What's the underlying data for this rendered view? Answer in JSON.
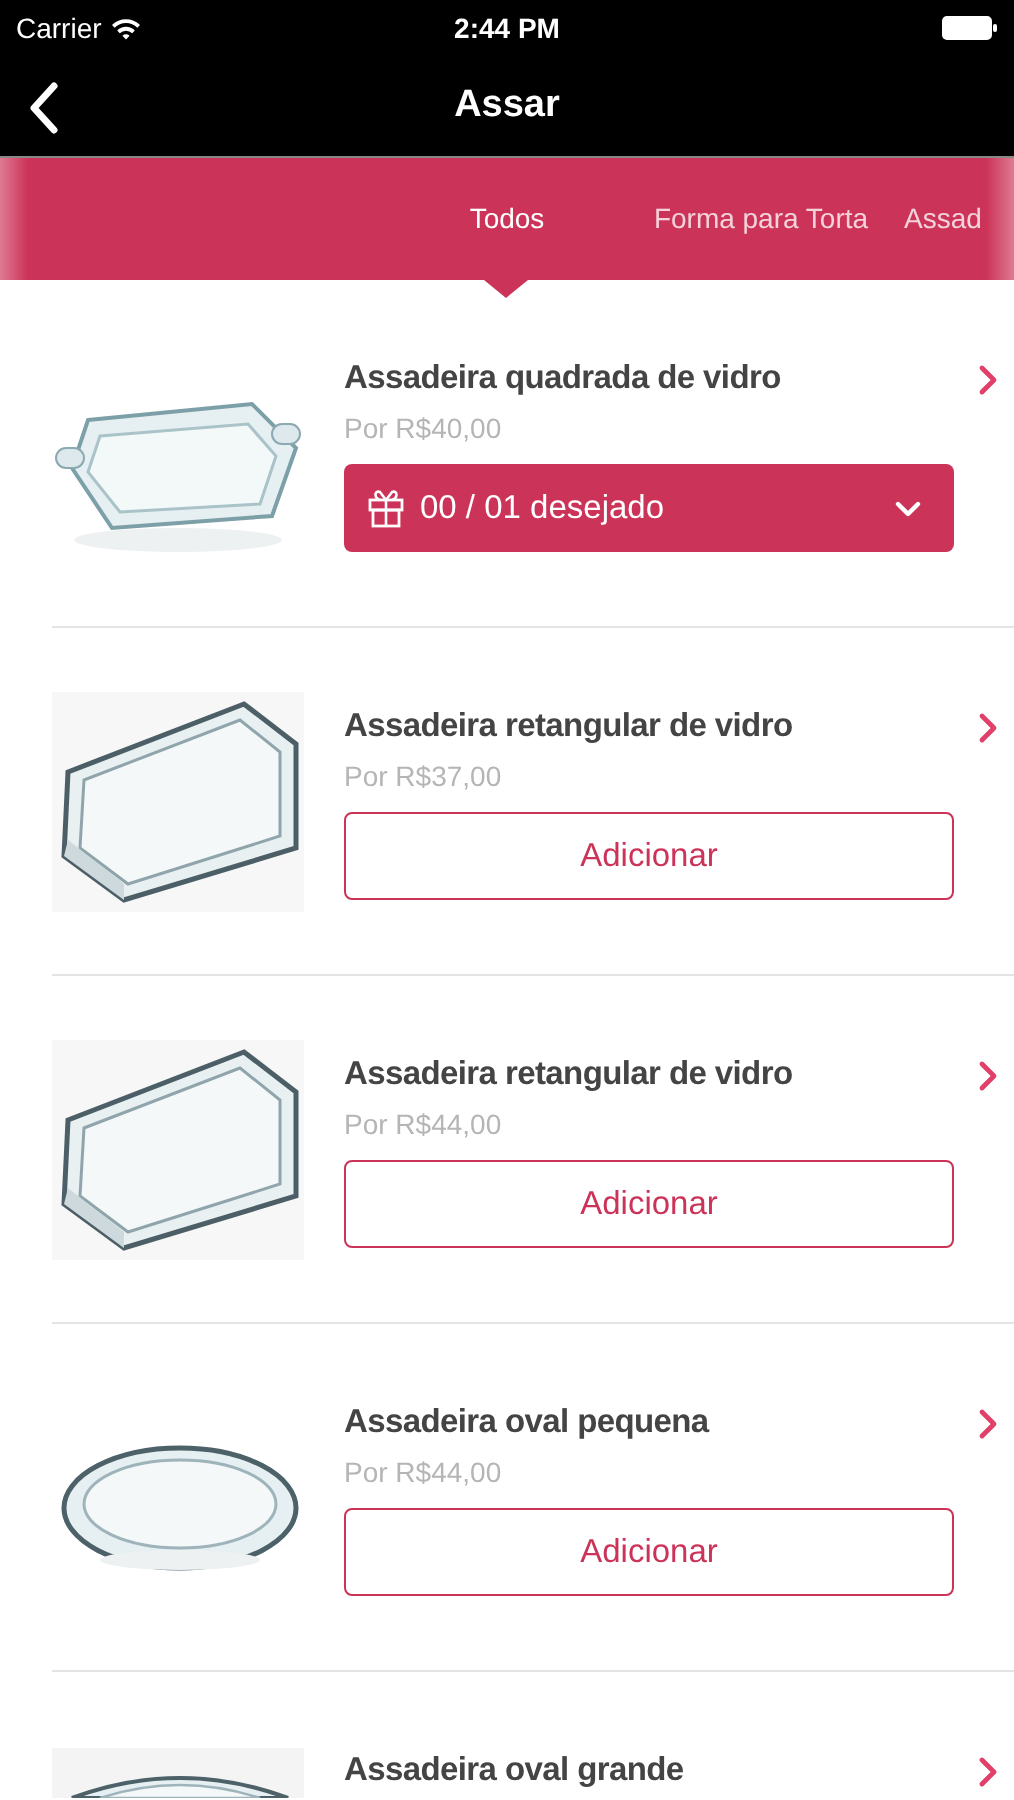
{
  "status_bar": {
    "carrier": "Carrier",
    "time": "2:44 PM"
  },
  "navbar": {
    "title": "Assar"
  },
  "tabs": [
    {
      "label": "Todos",
      "selected": true
    },
    {
      "label": "Forma para Torta",
      "selected": false
    },
    {
      "label": "Assad",
      "selected": false
    }
  ],
  "products": [
    {
      "kind": "wishlist",
      "name": "Assadeira quadrada de vidro",
      "price": "Por R$40,00",
      "action": "00 / 01 desejado"
    },
    {
      "kind": "add",
      "name": "Assadeira retangular de vidro",
      "price": "Por R$37,00",
      "action": "Adicionar"
    },
    {
      "kind": "add",
      "name": "Assadeira retangular de vidro",
      "price": "Por R$44,00",
      "action": "Adicionar"
    },
    {
      "kind": "add",
      "name": "Assadeira oval pequena",
      "price": "Por R$44,00",
      "action": "Adicionar"
    },
    {
      "kind": "peek",
      "name": "Assadeira oval grande"
    }
  ]
}
